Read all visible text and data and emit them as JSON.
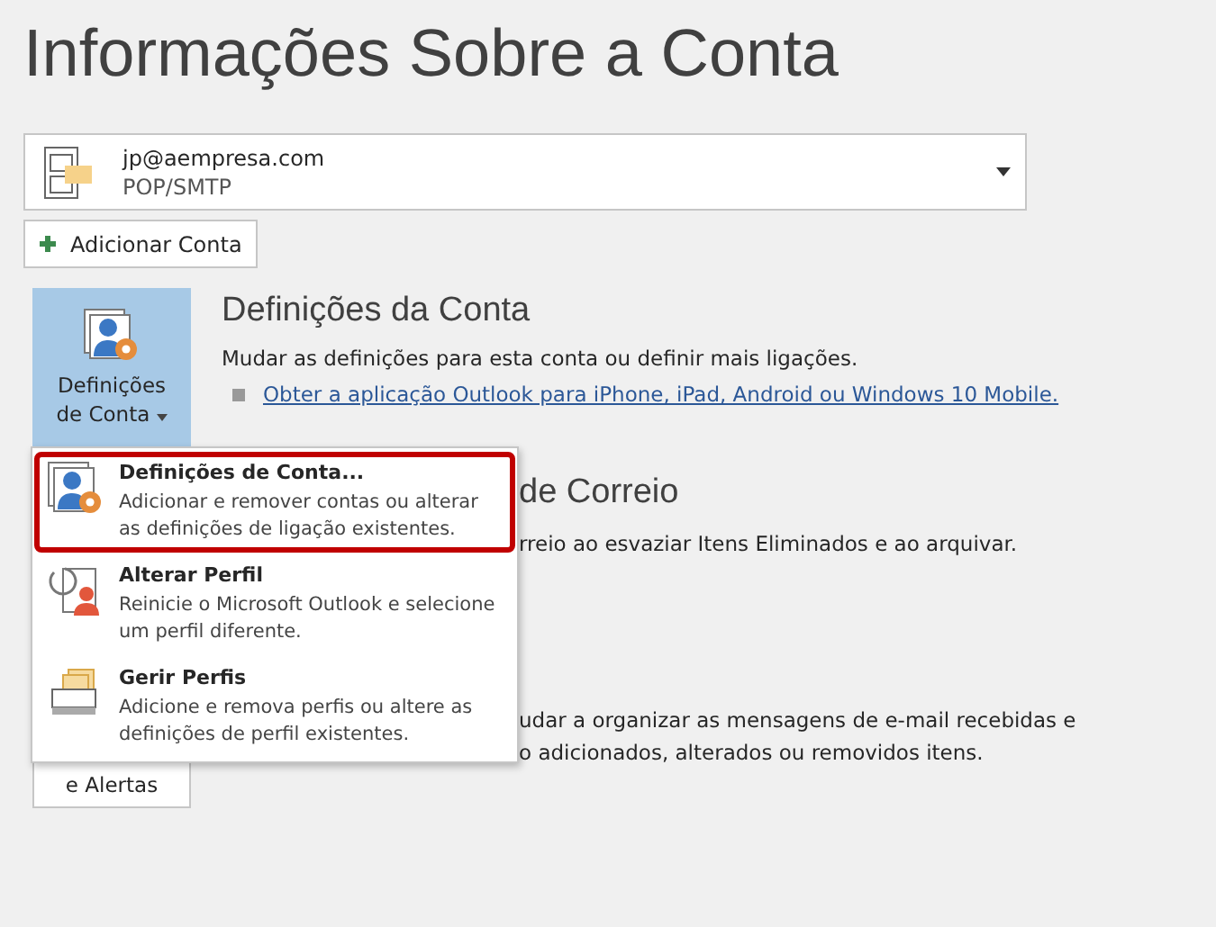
{
  "title": "Informações Sobre a Conta",
  "account": {
    "email": "jp@aempresa.com",
    "type": "POP/SMTP"
  },
  "add_account": {
    "label": "Adicionar Conta"
  },
  "account_settings": {
    "button": {
      "line1": "Definições",
      "line2": "de Conta",
      "expanded": true
    },
    "heading": "Definições da Conta",
    "description": "Mudar as definições para esta conta ou definir mais ligações.",
    "link": "Obter a aplicação Outlook para iPhone, iPad, Android ou Windows 10 Mobile."
  },
  "mailbox_fragment": {
    "heading": "de Correio",
    "description": "rreio ao esvaziar Itens Eliminados e ao arquivar."
  },
  "rules_fragment": {
    "button": "e Alertas",
    "lines": [
      "udar a organizar as mensagens de e-mail recebidas e",
      "o adicionados, alterados ou removidos itens."
    ]
  },
  "menu": [
    {
      "kind": "settings",
      "title": "Definições de Conta...",
      "description": "Adicionar e remover contas ou alterar as definições de ligação existentes.",
      "selected": true
    },
    {
      "kind": "profile",
      "title": "Alterar Perfil",
      "description": "Reinicie o Microsoft Outlook e selecione um perfil diferente.",
      "selected": false
    },
    {
      "kind": "profiles",
      "title": "Gerir Perfis",
      "description": "Adicione e remova perfis ou altere as definições de perfil existentes.",
      "selected": false
    }
  ]
}
